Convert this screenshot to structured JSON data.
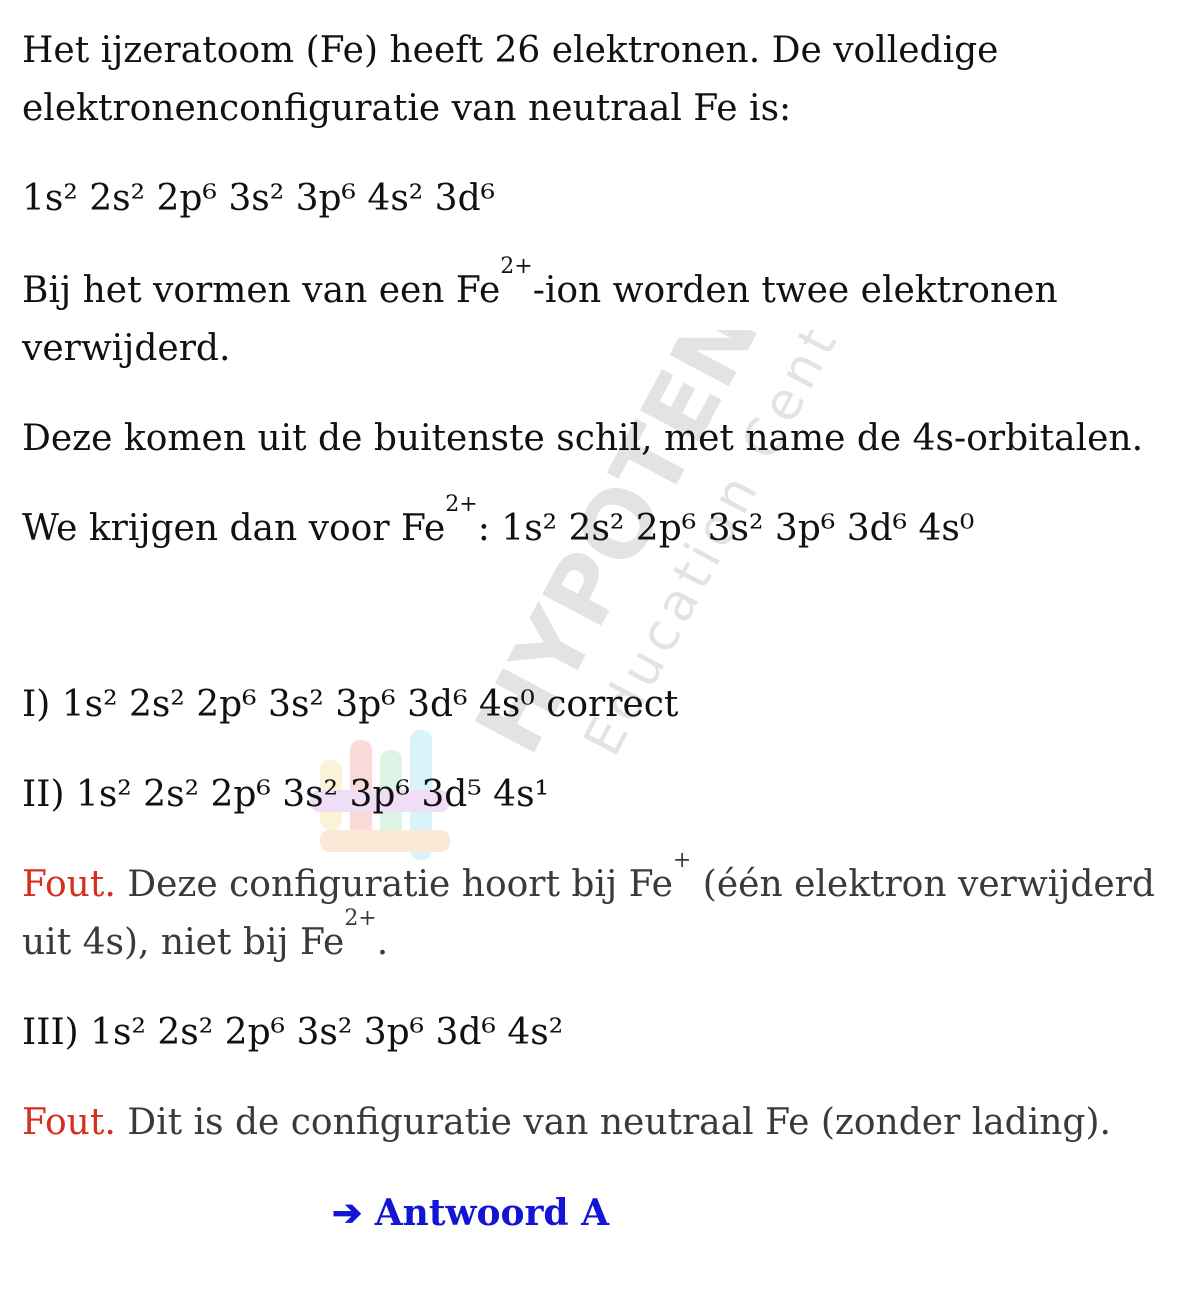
{
  "intro": {
    "line1": "Het ijzeratoom (Fe) heeft 26 elektronen. De volledige",
    "line2": "elektronenconfiguratie van neutraal Fe is:"
  },
  "neutral_config": "1s² 2s² 2p⁶ 3s² 3p⁶ 4s² 3d⁶",
  "ion_intro": {
    "part1": "Bij het vormen van een Fe",
    "sup": "2+",
    "part2": "-ion worden twee elektronen",
    "line2": "verwijderd."
  },
  "removal_note": "Deze komen uit de buitenste schil, met name de 4s-orbitalen.",
  "result": {
    "prefix": "We krijgen dan voor Fe",
    "sup": "2+",
    "config": ": 1s² 2s² 2p⁶ 3s² 3p⁶ 3d⁶ 4s⁰"
  },
  "options": {
    "i": "I) 1s² 2s² 2p⁶ 3s² 3p⁶ 3d⁶ 4s⁰ correct",
    "ii": "II) 1s² 2s² 2p⁶ 3s² 3p⁶ 3d⁵ 4s¹",
    "ii_feedback": {
      "label": "Fout.",
      "text1": " Deze configuratie hoort bij Fe",
      "sup1": "+",
      "text2": " (één elektron verwijderd",
      "text3": "uit 4s), niet bij Fe",
      "sup2": "2+",
      "text4": "."
    },
    "iii": "III) 1s² 2s² 2p⁶ 3s² 3p⁶ 3d⁶ 4s²",
    "iii_feedback": {
      "label": "Fout.",
      "text": " Dit is de configuratie van neutraal Fe (zonder lading)."
    }
  },
  "answer": {
    "arrow": "➔",
    "text": "Antwoord A"
  },
  "watermark": {
    "brand": "HYPOTENUSE",
    "sub": "Education Center"
  },
  "colors": {
    "fout": "#d5301f",
    "answer": "#1414d4"
  }
}
